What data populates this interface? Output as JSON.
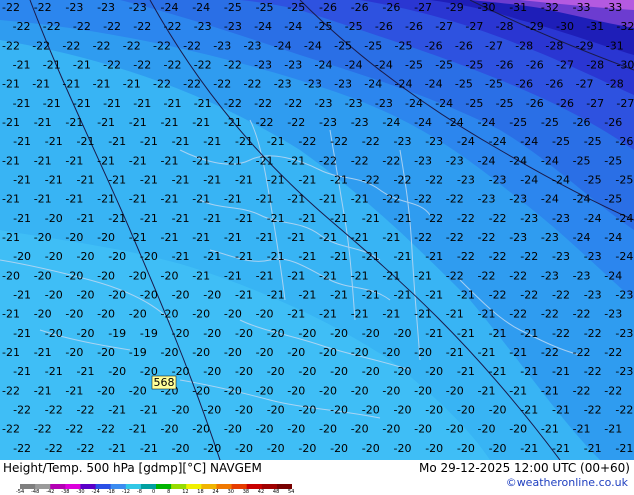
{
  "map": {
    "contour_values": [
      -21,
      -22,
      -23,
      -24,
      -25,
      -26,
      -27,
      -28,
      -29,
      -30,
      -31,
      -32,
      -33,
      -20,
      -19
    ],
    "height_label": "568",
    "rows": [
      {
        "vals": [
          "-22",
          "-22",
          "-23",
          "-23",
          "-23",
          "-24",
          "-24",
          "-25",
          "-25",
          "-25",
          "-26",
          "-26",
          "-26",
          "-27",
          "-29",
          "-30",
          "-31",
          "-32",
          "-33",
          "-33"
        ]
      },
      {
        "vals": [
          "-22",
          "-22",
          "-22",
          "-22",
          "-22",
          "-22",
          "-23",
          "-23",
          "-24",
          "-24",
          "-25",
          "-25",
          "-26",
          "-26",
          "-27",
          "-27",
          "-28",
          "-29",
          "-30",
          "-31",
          "-32"
        ]
      },
      {
        "vals": [
          "-22",
          "-22",
          "-22",
          "-22",
          "-22",
          "-22",
          "-22",
          "-23",
          "-23",
          "-24",
          "-24",
          "-25",
          "-25",
          "-25",
          "-26",
          "-26",
          "-27",
          "-28",
          "-28",
          "-29",
          "-31"
        ]
      },
      {
        "vals": [
          "-21",
          "-21",
          "-21",
          "-22",
          "-22",
          "-22",
          "-22",
          "-22",
          "-23",
          "-23",
          "-24",
          "-24",
          "-24",
          "-25",
          "-25",
          "-25",
          "-26",
          "-26",
          "-27",
          "-28",
          "-30"
        ]
      },
      {
        "vals": [
          "-21",
          "-21",
          "-21",
          "-21",
          "-21",
          "-22",
          "-22",
          "-22",
          "-22",
          "-23",
          "-23",
          "-23",
          "-24",
          "-24",
          "-24",
          "-25",
          "-25",
          "-26",
          "-26",
          "-27",
          "-28"
        ]
      },
      {
        "vals": [
          "-21",
          "-21",
          "-21",
          "-21",
          "-21",
          "-21",
          "-21",
          "-22",
          "-22",
          "-22",
          "-23",
          "-23",
          "-23",
          "-24",
          "-24",
          "-25",
          "-25",
          "-26",
          "-26",
          "-27",
          "-27"
        ]
      },
      {
        "vals": [
          "-21",
          "-21",
          "-21",
          "-21",
          "-21",
          "-21",
          "-21",
          "-21",
          "-22",
          "-22",
          "-23",
          "-23",
          "-24",
          "-24",
          "-24",
          "-24",
          "-25",
          "-25",
          "-26",
          "-26"
        ]
      },
      {
        "vals": [
          "-21",
          "-21",
          "-21",
          "-21",
          "-21",
          "-21",
          "-21",
          "-21",
          "-21",
          "-22",
          "-22",
          "-22",
          "-23",
          "-23",
          "-24",
          "-24",
          "-24",
          "-25",
          "-25",
          "-26"
        ]
      },
      {
        "vals": [
          "-21",
          "-21",
          "-21",
          "-21",
          "-21",
          "-21",
          "-21",
          "-21",
          "-21",
          "-21",
          "-22",
          "-22",
          "-22",
          "-23",
          "-23",
          "-24",
          "-24",
          "-24",
          "-25",
          "-25"
        ]
      },
      {
        "vals": [
          "-21",
          "-21",
          "-21",
          "-21",
          "-21",
          "-21",
          "-21",
          "-21",
          "-21",
          "-21",
          "-21",
          "-22",
          "-22",
          "-22",
          "-23",
          "-23",
          "-24",
          "-24",
          "-25",
          "-25"
        ]
      },
      {
        "vals": [
          "-21",
          "-21",
          "-21",
          "-21",
          "-21",
          "-21",
          "-21",
          "-21",
          "-21",
          "-21",
          "-21",
          "-21",
          "-22",
          "-22",
          "-22",
          "-23",
          "-23",
          "-24",
          "-24",
          "-25"
        ]
      },
      {
        "vals": [
          "-21",
          "-20",
          "-21",
          "-21",
          "-21",
          "-21",
          "-21",
          "-21",
          "-21",
          "-21",
          "-21",
          "-21",
          "-21",
          "-22",
          "-22",
          "-22",
          "-23",
          "-23",
          "-24",
          "-24"
        ]
      },
      {
        "vals": [
          "-21",
          "-20",
          "-20",
          "-20",
          "-21",
          "-21",
          "-21",
          "-21",
          "-21",
          "-21",
          "-21",
          "-21",
          "-21",
          "-22",
          "-22",
          "-22",
          "-23",
          "-23",
          "-24",
          "-24"
        ]
      },
      {
        "vals": [
          "-20",
          "-20",
          "-20",
          "-20",
          "-20",
          "-21",
          "-21",
          "-21",
          "-21",
          "-21",
          "-21",
          "-21",
          "-21",
          "-21",
          "-22",
          "-22",
          "-22",
          "-23",
          "-23",
          "-24"
        ]
      },
      {
        "vals": [
          "-20",
          "-20",
          "-20",
          "-20",
          "-20",
          "-20",
          "-21",
          "-21",
          "-21",
          "-21",
          "-21",
          "-21",
          "-21",
          "-21",
          "-22",
          "-22",
          "-22",
          "-23",
          "-23",
          "-24"
        ]
      },
      {
        "vals": [
          "-21",
          "-20",
          "-20",
          "-20",
          "-20",
          "-20",
          "-20",
          "-21",
          "-21",
          "-21",
          "-21",
          "-21",
          "-21",
          "-21",
          "-21",
          "-22",
          "-22",
          "-22",
          "-23",
          "-23"
        ]
      },
      {
        "vals": [
          "-21",
          "-20",
          "-20",
          "-20",
          "-20",
          "-20",
          "-20",
          "-20",
          "-20",
          "-21",
          "-21",
          "-21",
          "-21",
          "-21",
          "-21",
          "-21",
          "-22",
          "-22",
          "-22",
          "-23"
        ]
      },
      {
        "vals": [
          "-21",
          "-20",
          "-20",
          "-19",
          "-19",
          "-20",
          "-20",
          "-20",
          "-20",
          "-20",
          "-20",
          "-20",
          "-20",
          "-21",
          "-21",
          "-21",
          "-21",
          "-22",
          "-22",
          "-23"
        ]
      },
      {
        "vals": [
          "-21",
          "-21",
          "-20",
          "-20",
          "-19",
          "-20",
          "-20",
          "-20",
          "-20",
          "-20",
          "-20",
          "-20",
          "-20",
          "-20",
          "-21",
          "-21",
          "-21",
          "-22",
          "-22",
          "-22"
        ]
      },
      {
        "vals": [
          "-21",
          "-21",
          "-21",
          "-20",
          "-20",
          "-20",
          "-20",
          "-20",
          "-20",
          "-20",
          "-20",
          "-20",
          "-20",
          "-20",
          "-21",
          "-21",
          "-21",
          "-21",
          "-22",
          "-23"
        ]
      },
      {
        "vals": [
          "-22",
          "-21",
          "-21",
          "-20",
          "-20",
          "-20",
          "-20",
          "-20",
          "-20",
          "-20",
          "-20",
          "-20",
          "-20",
          "-20",
          "-20",
          "-21",
          "-21",
          "-21",
          "-22",
          "-22"
        ]
      },
      {
        "vals": [
          "-22",
          "-22",
          "-22",
          "-21",
          "-21",
          "-20",
          "-20",
          "-20",
          "-20",
          "-20",
          "-20",
          "-20",
          "-20",
          "-20",
          "-20",
          "-20",
          "-21",
          "-21",
          "-22",
          "-22"
        ]
      },
      {
        "vals": [
          "-22",
          "-22",
          "-22",
          "-22",
          "-21",
          "-20",
          "-20",
          "-20",
          "-20",
          "-20",
          "-20",
          "-20",
          "-20",
          "-20",
          "-20",
          "-20",
          "-20",
          "-21",
          "-21",
          "-21"
        ]
      },
      {
        "vals": [
          "-22",
          "-22",
          "-22",
          "-21",
          "-21",
          "-20",
          "-20",
          "-20",
          "-20",
          "-20",
          "-20",
          "-20",
          "-20",
          "-20",
          "-20",
          "-20",
          "-21",
          "-21",
          "-21",
          "-21"
        ]
      }
    ]
  },
  "footer": {
    "title_left": "Height/Temp. 500 hPa [gdmp][°C] NAVGEM",
    "title_right": "Mo 29-12-2025 12:00 UTC (00+60)",
    "credit": "©weatheronline.co.uk",
    "colorbar_labels": [
      "-54",
      "-48",
      "-42",
      "-38",
      "-30",
      "-24",
      "-18",
      "-12",
      "-8",
      "0",
      "8",
      "12",
      "18",
      "24",
      "30",
      "38",
      "42",
      "48",
      "54"
    ],
    "colorbar_colors": [
      "#7f7f7f",
      "#9a9a9a",
      "#b400b4",
      "#dc00dc",
      "#5a00c8",
      "#2a50e6",
      "#3c8cf0",
      "#32c8e6",
      "#00a0a0",
      "#00b400",
      "#96dc00",
      "#f0f000",
      "#f0b400",
      "#f07800",
      "#e63c00",
      "#c80000",
      "#a00000",
      "#780000"
    ]
  }
}
